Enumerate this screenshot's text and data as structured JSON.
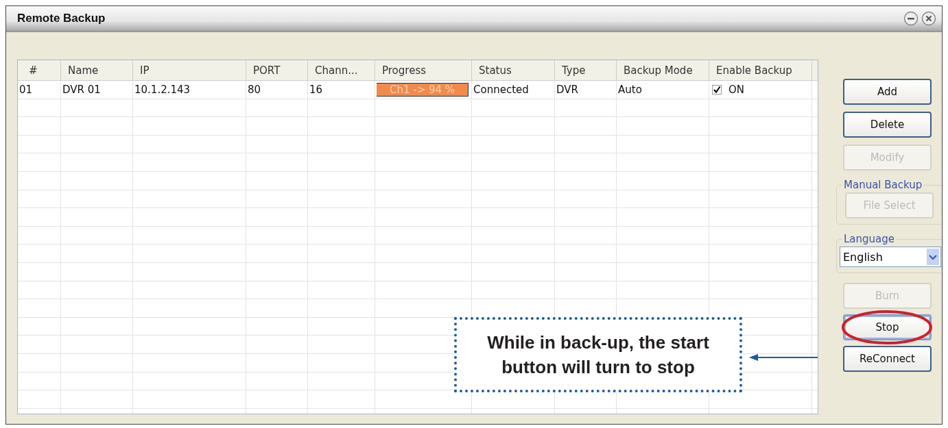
{
  "window": {
    "title": "Remote Backup"
  },
  "table": {
    "columns": [
      "#",
      "Name",
      "IP",
      "PORT",
      "Chann...",
      "Progress",
      "Status",
      "Type",
      "Backup Mode",
      "Enable Backup"
    ],
    "rows": [
      {
        "number": "01",
        "name": "DVR 01",
        "ip": "10.1.2.143",
        "port": "80",
        "channels": "16",
        "progress": "Ch1 -> 94 %",
        "status": "Connected",
        "type": "DVR",
        "backup_mode": "Auto",
        "enable_backup": {
          "checked": true,
          "label": "ON"
        }
      }
    ]
  },
  "buttons_top": [
    {
      "label": "Add",
      "disabled": false
    },
    {
      "label": "Delete",
      "disabled": false
    },
    {
      "label": "Modify",
      "disabled": true
    }
  ],
  "manual_backup": {
    "title": "Manual Backup",
    "button": {
      "label": "File Select",
      "disabled": true
    }
  },
  "language": {
    "title": "Language",
    "value": "English"
  },
  "buttons_bottom": [
    {
      "label": "Burn",
      "disabled": true,
      "highlighted": false
    },
    {
      "label": "Stop",
      "disabled": false,
      "highlighted": true
    },
    {
      "label": "ReConnect",
      "disabled": false,
      "highlighted": false
    }
  ],
  "callout": {
    "lines": [
      "While in back-up, the start",
      "button will turn to stop"
    ]
  }
}
